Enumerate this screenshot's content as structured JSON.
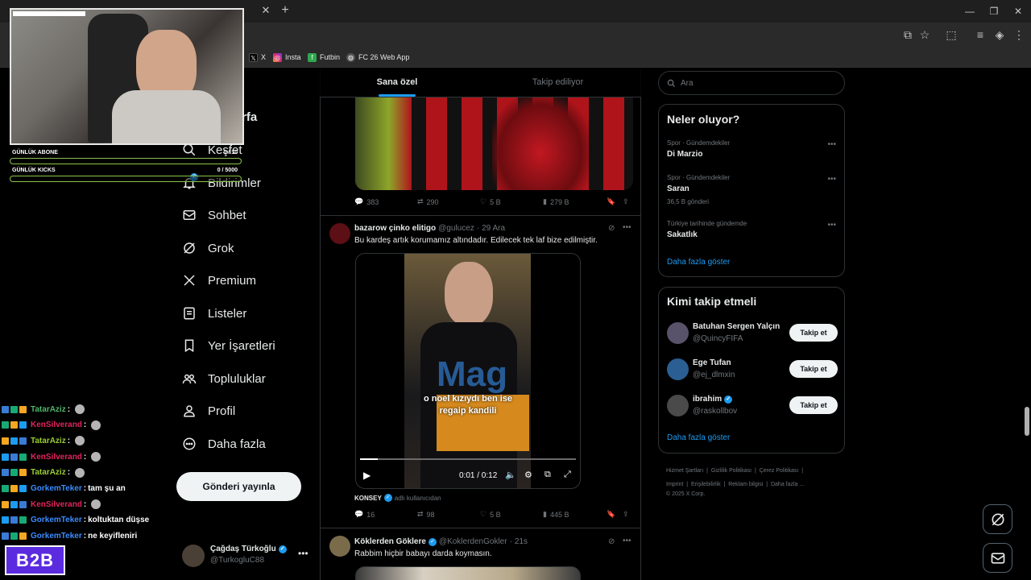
{
  "browser": {
    "bookmarks": [
      {
        "label": "X",
        "icon": "x-logo-icon"
      },
      {
        "label": "Insta",
        "icon": "instagram-icon"
      },
      {
        "label": "Futbin",
        "icon": "futbin-icon"
      },
      {
        "label": "FC 26 Web App",
        "icon": "globe-icon"
      }
    ]
  },
  "overlay": {
    "progress": [
      {
        "label": "GÜNLÜK ABONE",
        "value_text": "0 / 10",
        "fraction": 0.0
      },
      {
        "label": "GÜNLÜK KICKS",
        "value_text": "0 / 5000",
        "fraction": 0.0
      }
    ],
    "chat": [
      {
        "user": "TatarAziz",
        "color": "#4fb56a",
        "text": ""
      },
      {
        "user": "KenSilverand",
        "color": "#e0245e",
        "text": ""
      },
      {
        "user": "TatarAziz",
        "color": "#9acd32",
        "text": ""
      },
      {
        "user": "KenSilverand",
        "color": "#e0245e",
        "text": ""
      },
      {
        "user": "TatarAziz",
        "color": "#9acd32",
        "text": ""
      },
      {
        "user": "GorkemTeker",
        "color": "#3b8cff",
        "text": "tam şu an"
      },
      {
        "user": "KenSilverand",
        "color": "#e0245e",
        "text": ""
      },
      {
        "user": "GorkemTeker",
        "color": "#3b8cff",
        "text": "koltuktan düşse"
      },
      {
        "user": "GorkemTeker",
        "color": "#3b8cff",
        "text": "ne keyifleniri"
      }
    ],
    "logo": "B2B"
  },
  "nav": {
    "partial_top": "rfa",
    "items": [
      {
        "label": "Keşfet",
        "icon": "search-icon"
      },
      {
        "label": "Bildirimler",
        "icon": "bell-icon"
      },
      {
        "label": "Sohbet",
        "icon": "mail-icon"
      },
      {
        "label": "Grok",
        "icon": "grok-icon"
      },
      {
        "label": "Premium",
        "icon": "x-logo-icon"
      },
      {
        "label": "Listeler",
        "icon": "list-icon"
      },
      {
        "label": "Yer İşaretleri",
        "icon": "bookmark-icon"
      },
      {
        "label": "Topluluklar",
        "icon": "communities-icon"
      },
      {
        "label": "Profil",
        "icon": "profile-icon"
      },
      {
        "label": "Daha fazla",
        "icon": "more-circle-icon"
      }
    ],
    "post_button": "Gönderi yayınla",
    "notif_badge": "2",
    "account": {
      "name": "Çağdaş Türkoğlu",
      "handle": "@TurkogluC88"
    }
  },
  "timeline": {
    "tabs": [
      "Sana özel",
      "Takip ediliyor"
    ],
    "tweet1_stats": {
      "replies": "383",
      "retweets": "290",
      "likes": "5 B",
      "views": "279 B"
    },
    "tweet2": {
      "name": "bazarow çinko elitigo",
      "handle": "@gulucez",
      "date": "29 Ara",
      "text": "Bu kardeş artık korumamız altındadır. Edilecek tek laf bize edilmiştir.",
      "video_caption_1": "o noel kızıydı ben ise",
      "video_caption_2": "regaip kandili",
      "video_time": "0:01 / 0:12",
      "video_progress": 0.083,
      "source_name": "KONSEY",
      "source_note": "adlı kullanıcıdan",
      "stats": {
        "replies": "16",
        "retweets": "98",
        "likes": "5 B",
        "views": "445 B"
      }
    },
    "tweet3": {
      "name": "Köklerden Göklere",
      "handle": "@KoklerdenGokler",
      "date": "21s",
      "text": "Rabbim hiçbir babayı darda koymasın."
    }
  },
  "sidebar": {
    "search_placeholder": "Ara",
    "trends_title": "Neler oluyor?",
    "trends": [
      {
        "meta": "Spor · Gündemdekiler",
        "name": "Di Marzio",
        "count": ""
      },
      {
        "meta": "Spor · Gündemdekiler",
        "name": "Saran",
        "count": "36,5 B gönderi"
      },
      {
        "meta": "Türkiye tarihinde gündemde",
        "name": "Sakatlık",
        "count": ""
      }
    ],
    "trends_more": "Daha fazla göster",
    "follow_title": "Kimi takip etmeli",
    "follow": [
      {
        "name": "Batuhan Sergen Yalçın",
        "handle": "@QuincyFIFA",
        "verified": false
      },
      {
        "name": "Ege Tufan",
        "handle": "@ej_dlmxin",
        "verified": false
      },
      {
        "name": "ibrahim",
        "handle": "@raskollbov",
        "verified": true
      }
    ],
    "follow_button": "Takip et",
    "follow_more": "Daha fazla göster",
    "footer": [
      "Hizmet Şartları",
      "Gizlilik Politikası",
      "Çerez Politikası",
      "Imprint",
      "Erişilebilirlik",
      "Reklam bilgisi",
      "Daha fazla ...",
      "© 2025 X Corp."
    ]
  },
  "colors": {
    "accent": "#1d9bf0",
    "background": "#000000",
    "border": "#2f3336",
    "muted": "#71767b"
  }
}
